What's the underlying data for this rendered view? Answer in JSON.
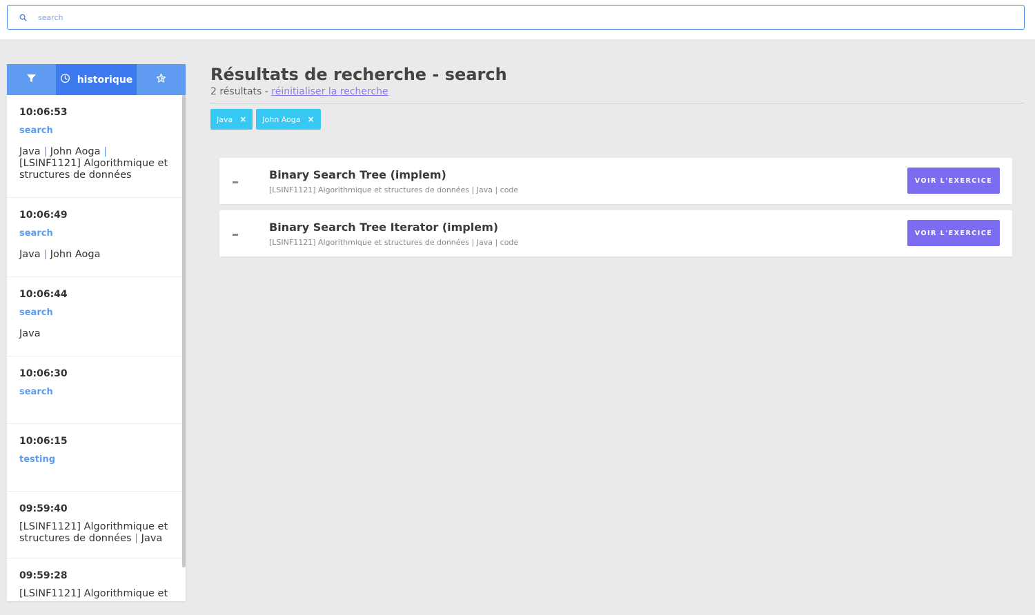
{
  "search": {
    "placeholder": "search",
    "value": ""
  },
  "sidebar": {
    "tabs": [
      {
        "icon": "filter-icon",
        "label": ""
      },
      {
        "icon": "clock-icon",
        "label": "historique",
        "active": true
      },
      {
        "icon": "star-icon",
        "label": ""
      }
    ],
    "history": [
      {
        "time": "10:06:53",
        "query": "search",
        "tags": [
          "Java",
          "John Aoga",
          "[LSINF1121] Algorithmique et structures de données"
        ]
      },
      {
        "time": "10:06:49",
        "query": "search",
        "tags": [
          "Java",
          "John Aoga"
        ]
      },
      {
        "time": "10:06:44",
        "query": "search",
        "tags": [
          "Java"
        ]
      },
      {
        "time": "10:06:30",
        "query": "search",
        "tags": []
      },
      {
        "time": "10:06:15",
        "query": "testing",
        "tags": []
      },
      {
        "time": "09:59:40",
        "query": "",
        "tags": [
          "[LSINF1121] Algorithmique et structures de données",
          "Java"
        ]
      },
      {
        "time": "09:59:28",
        "query": "",
        "tags": [
          "[LSINF1121] Algorithmique et"
        ]
      }
    ]
  },
  "main": {
    "title": "Résultats de recherche - search",
    "results_count": "2 résultats - ",
    "reset_label": "réinitialiser la recherche",
    "chips": [
      "Java",
      "John Aoga"
    ],
    "results": [
      {
        "title": "Binary Search Tree (implem)",
        "meta": "[LSINF1121] Algorithmique et structures de données | Java | code",
        "button": "VOIR L'EXERCICE"
      },
      {
        "title": "Binary Search Tree Iterator (implem)",
        "meta": "[LSINF1121] Algorithmique et structures de données | Java | code",
        "button": "VOIR L'EXERCICE"
      }
    ]
  },
  "colors": {
    "accent": "#3d7af0",
    "tab": "#5f9bf0",
    "chip": "#38c8f4",
    "button": "#7b6cf2",
    "link": "#8b7cf0"
  }
}
